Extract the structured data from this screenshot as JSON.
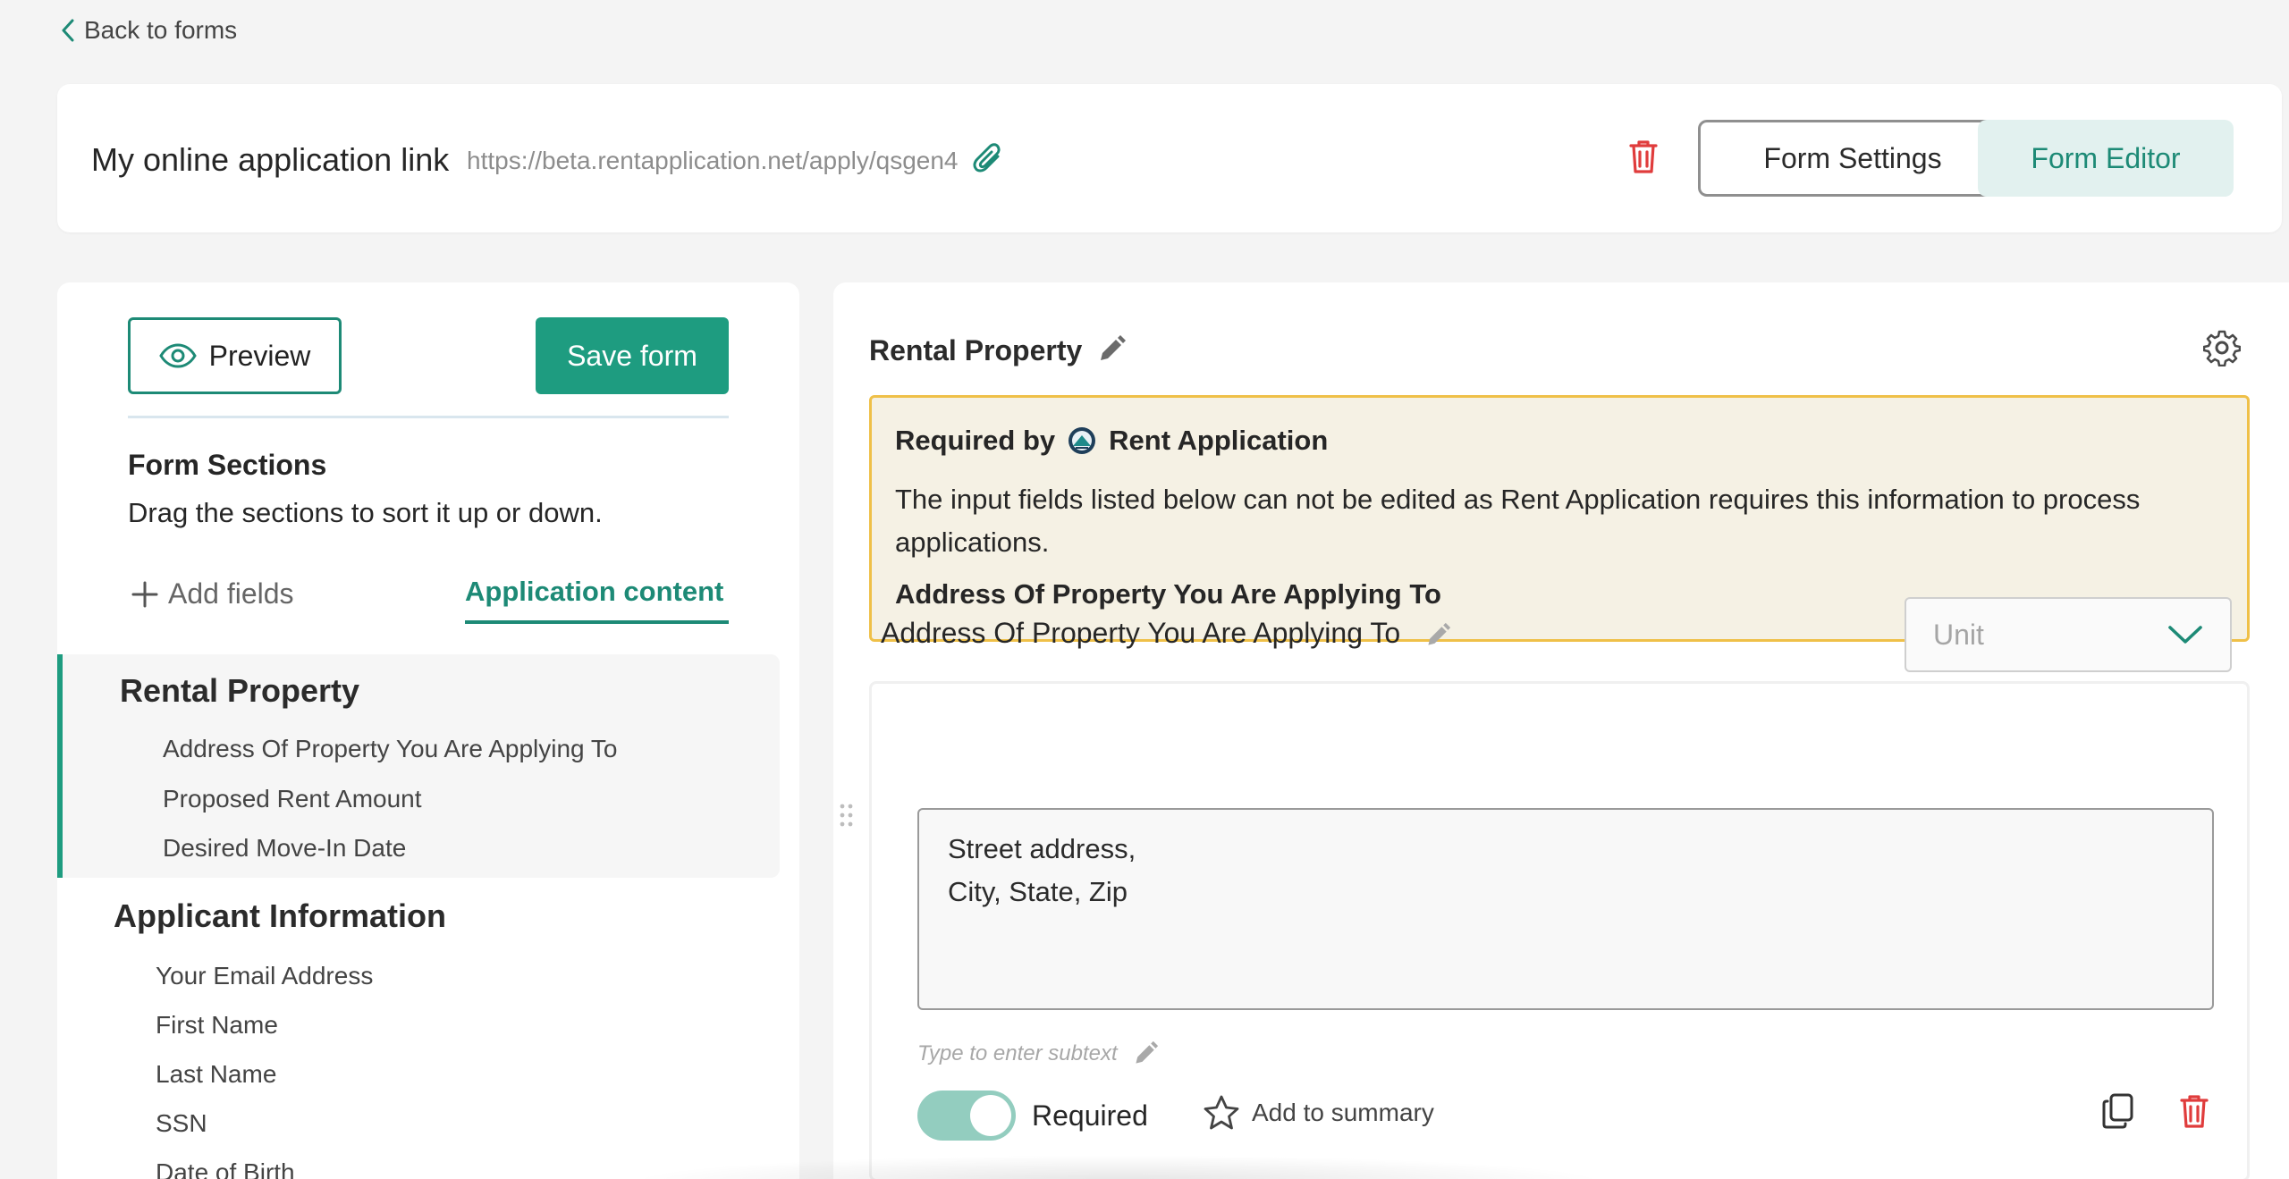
{
  "nav": {
    "back_label": "Back to forms"
  },
  "header": {
    "link_title": "My online application link",
    "link_url": "https://beta.rentapplication.net/apply/qsgen4",
    "form_settings_label": "Form Settings",
    "form_editor_label": "Form Editor"
  },
  "left": {
    "preview_label": "Preview",
    "save_label": "Save form",
    "sections_title": "Form Sections",
    "sections_subtitle": "Drag the sections to sort it up or down.",
    "add_fields_label": "Add fields",
    "app_content_tab": "Application content",
    "sections": [
      {
        "title": "Rental Property",
        "fields": [
          "Address Of Property You Are Applying To",
          "Proposed Rent Amount",
          "Desired Move-In Date"
        ]
      },
      {
        "title": "Applicant Information",
        "fields": [
          "Your Email Address",
          "First Name",
          "Last Name",
          "SSN",
          "Date of Birth"
        ]
      }
    ]
  },
  "right": {
    "section_title": "Rental Property",
    "notice": {
      "required_by": "Required by",
      "app_name": "Rent Application",
      "body": "The input fields listed below can not be edited as Rent Application requires this information to process applications.",
      "field_name": "Address Of Property You Are Applying To"
    },
    "field": {
      "label": "Address Of Property You Are Applying To",
      "unit_placeholder": "Unit",
      "address_line1": "Street address,",
      "address_line2": "City, State, Zip",
      "subtext_placeholder": "Type to enter subtext",
      "required_label": "Required",
      "required_on": true,
      "add_summary_label": "Add to summary"
    }
  },
  "colors": {
    "accent": "#1e9c80",
    "accent_text": "#1d8a76",
    "danger": "#e03c3c",
    "notice_bg": "#f5f1e4",
    "notice_border": "#efc048"
  }
}
